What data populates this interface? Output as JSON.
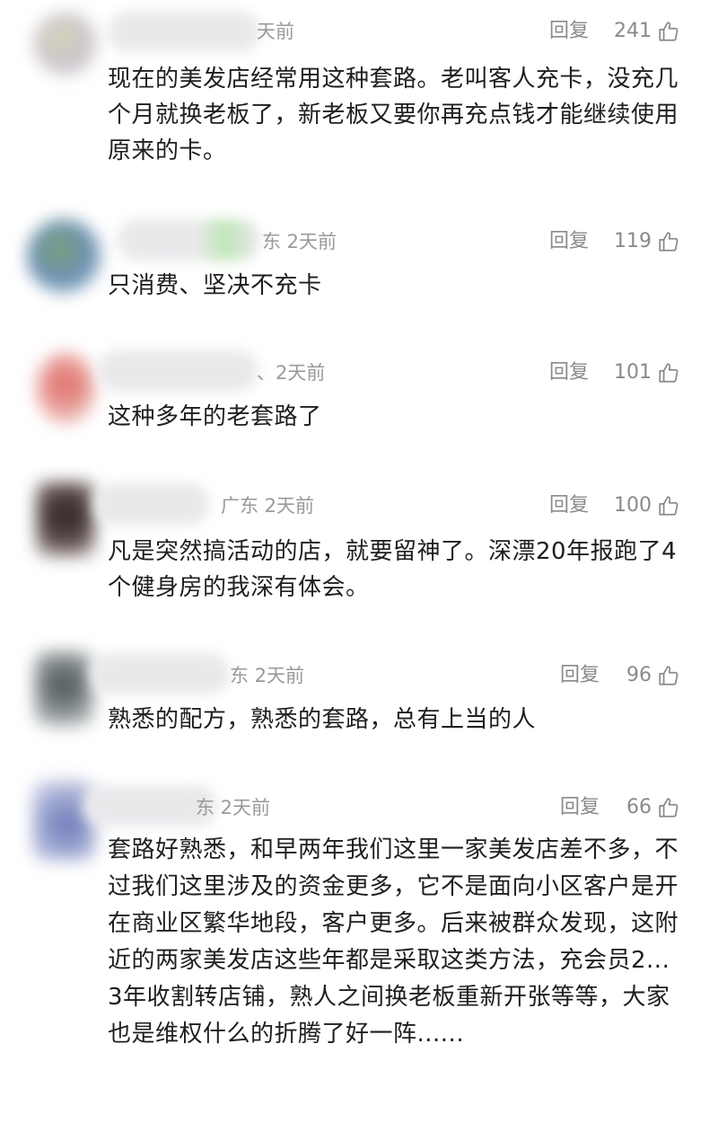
{
  "comments": [
    {
      "time": "天前",
      "reply_label": "回复",
      "likes": "241",
      "text": "现在的美发店经常用这种套路。老叫客人充卡，没充几个月就换老板了，新老板又要你再充点钱才能继续使用原来的卡。"
    },
    {
      "time": "东 2天前",
      "reply_label": "回复",
      "likes": "119",
      "text": "只消费、坚决不充卡"
    },
    {
      "time": "、2天前",
      "reply_label": "回复",
      "likes": "101",
      "text": "这种多年的老套路了"
    },
    {
      "time": "广东  2天前",
      "reply_label": "回复",
      "likes": "100",
      "text": "凡是突然搞活动的店，就要留神了。深漂20年报跑了4个健身房的我深有体会。"
    },
    {
      "time": "东 2天前",
      "reply_label": "回复",
      "likes": "96",
      "text": "熟悉的配方，熟悉的套路，总有上当的人"
    },
    {
      "time": "东 2天前",
      "reply_label": "回复",
      "likes": "66",
      "text": "套路好熟悉，和早两年我们这里一家美发店差不多，不过我们这里涉及的资金更多，它不是面向小区客户是开在商业区繁华地段，客户更多。后来被群众发现，这附近的两家美发店这些年都是采取这类方法，充会员2...3年收割转店铺，熟人之间换老板重新开张等等，大家也是维权什么的折腾了好一阵......"
    }
  ],
  "colors": {
    "meta_gray": "#9a9a9a",
    "text_dark": "#1e1e1e"
  }
}
